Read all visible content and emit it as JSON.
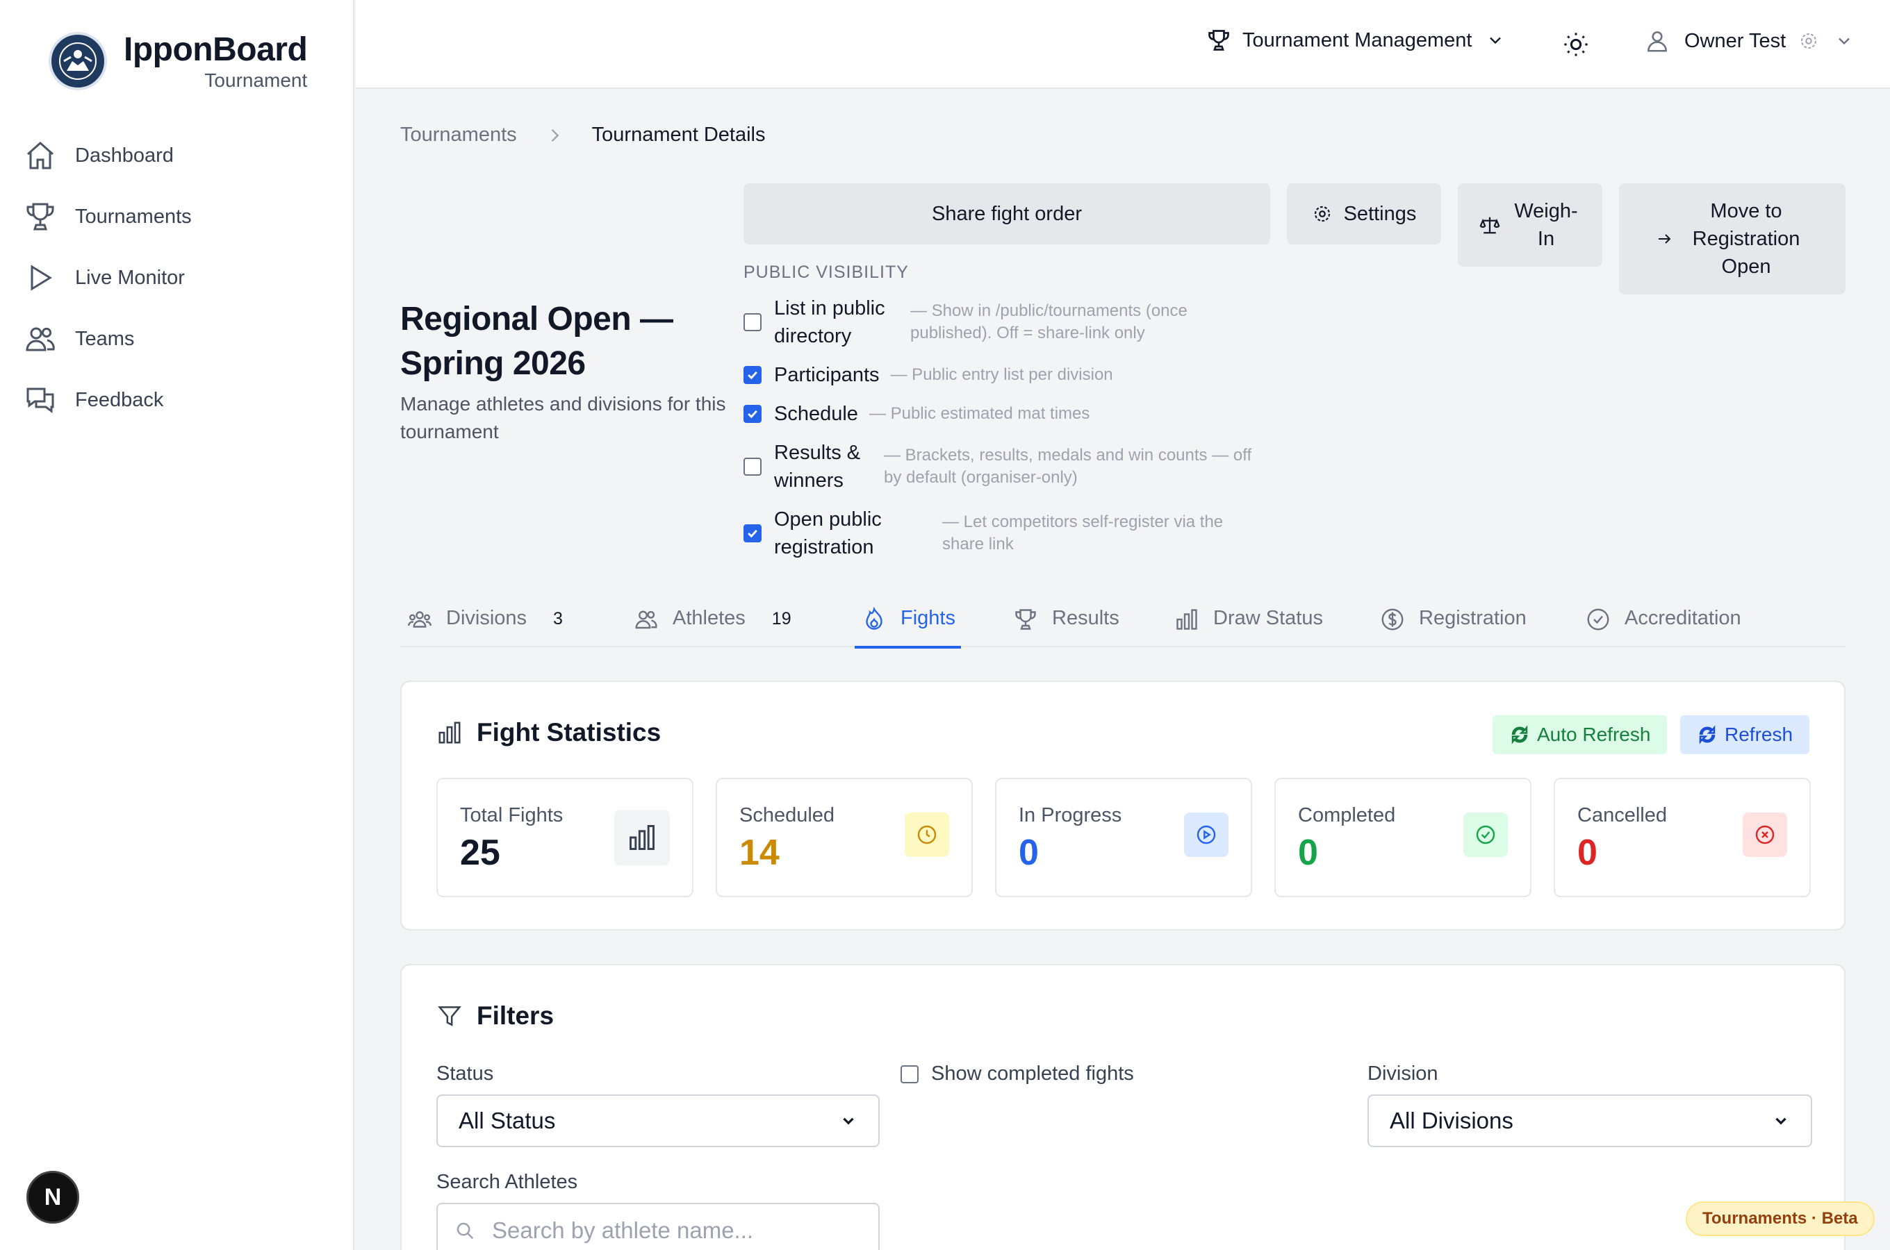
{
  "brand": {
    "title": "IpponBoard",
    "subtitle": "Tournament"
  },
  "sidebar": {
    "items": [
      {
        "label": "Dashboard",
        "icon": "home-icon"
      },
      {
        "label": "Tournaments",
        "icon": "trophy-icon"
      },
      {
        "label": "Live Monitor",
        "icon": "play-icon"
      },
      {
        "label": "Teams",
        "icon": "users-icon"
      },
      {
        "label": "Feedback",
        "icon": "chat-icon"
      }
    ],
    "badge": "N"
  },
  "topbar": {
    "management": "Tournament Management",
    "user": "Owner Test"
  },
  "breadcrumb": {
    "parent": "Tournaments",
    "current": "Tournament Details"
  },
  "header": {
    "title": "Regional Open — Spring 2026",
    "description": "Manage athletes and divisions for this tournament"
  },
  "actions": {
    "share": "Share fight order",
    "settings": "Settings",
    "weigh_in": "Weigh-In",
    "move": "Move to Registration Open"
  },
  "visibility": {
    "heading": "PUBLIC VISIBILITY",
    "options": [
      {
        "label": "List in public directory",
        "hint": "— Show in /public/tournaments (once published). Off = share-link only",
        "checked": false
      },
      {
        "label": "Participants",
        "hint": "— Public entry list per division",
        "checked": true
      },
      {
        "label": "Schedule",
        "hint": "— Public estimated mat times",
        "checked": true
      },
      {
        "label": "Results & winners",
        "hint": "— Brackets, results, medals and win counts — off by default (organiser-only)",
        "checked": false
      },
      {
        "label": "Open public registration",
        "hint": "— Let competitors self-register via the share link",
        "checked": true
      }
    ]
  },
  "tabs": [
    {
      "label": "Divisions",
      "count": "3",
      "active": false
    },
    {
      "label": "Athletes",
      "count": "19",
      "active": false
    },
    {
      "label": "Fights",
      "count": "",
      "active": true
    },
    {
      "label": "Results",
      "count": "",
      "active": false
    },
    {
      "label": "Draw Status",
      "count": "",
      "active": false
    },
    {
      "label": "Registration",
      "count": "",
      "active": false
    },
    {
      "label": "Accreditation",
      "count": "",
      "active": false
    }
  ],
  "stats": {
    "title": "Fight Statistics",
    "auto_refresh": "Auto Refresh",
    "refresh": "Refresh",
    "cards": [
      {
        "label": "Total Fights",
        "value": "25",
        "color": "#111827",
        "icon": "bar-chart-icon"
      },
      {
        "label": "Scheduled",
        "value": "14",
        "color": "#ca8a04",
        "icon": "clock-icon"
      },
      {
        "label": "In Progress",
        "value": "0",
        "color": "#2563eb",
        "icon": "play-circle-icon"
      },
      {
        "label": "Completed",
        "value": "0",
        "color": "#16a34a",
        "icon": "check-circle-icon"
      },
      {
        "label": "Cancelled",
        "value": "0",
        "color": "#dc2626",
        "icon": "x-circle-icon"
      }
    ]
  },
  "filters": {
    "title": "Filters",
    "status_label": "Status",
    "status_value": "All Status",
    "show_completed": "Show completed fights",
    "division_label": "Division",
    "division_value": "All Divisions",
    "search_label": "Search Athletes",
    "search_placeholder": "Search by athlete name..."
  },
  "footer_badge": "Tournaments · Beta",
  "colors": {
    "accent": "#2563eb",
    "success": "#16a34a",
    "warning": "#ca8a04",
    "danger": "#dc2626"
  }
}
